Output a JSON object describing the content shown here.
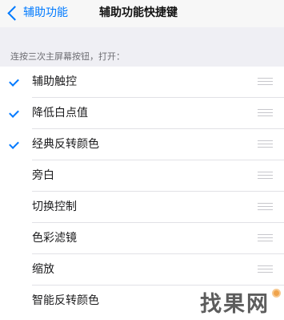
{
  "navbar": {
    "back_label": "辅助功能",
    "title": "辅助功能快捷键"
  },
  "section_header": "连按三次主屏幕按钮，打开：",
  "items": [
    {
      "label": "辅助触控",
      "checked": true
    },
    {
      "label": "降低白点值",
      "checked": true
    },
    {
      "label": "经典反转颜色",
      "checked": true
    },
    {
      "label": "旁白",
      "checked": false
    },
    {
      "label": "切换控制",
      "checked": false
    },
    {
      "label": "色彩滤镜",
      "checked": false
    },
    {
      "label": "缩放",
      "checked": false
    },
    {
      "label": "智能反转颜色",
      "checked": false
    }
  ],
  "watermark": {
    "text": "找果网"
  },
  "colors": {
    "accent": "#007aff",
    "background": "#efeff4"
  }
}
